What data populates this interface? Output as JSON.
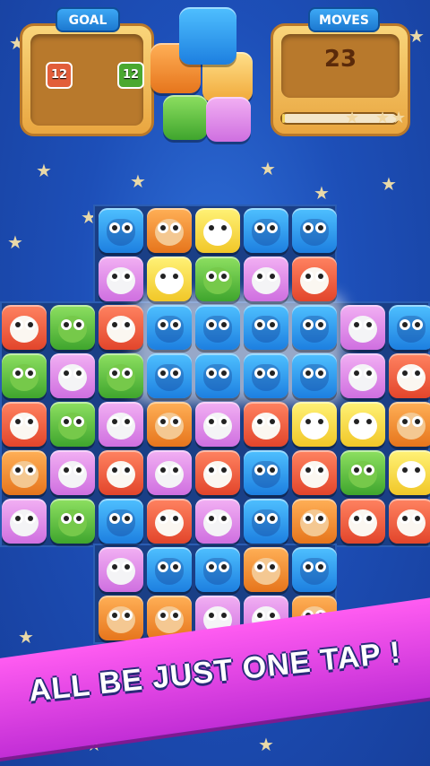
{
  "hud": {
    "goal_label": "GOAL",
    "moves_label": "MOVES",
    "moves_value": "23",
    "goals": [
      {
        "count": "12",
        "color": "#e25e3a"
      },
      {
        "count": "12",
        "color": "#4aa830"
      }
    ],
    "progress": 0.0
  },
  "banner": {
    "text": "ALL BE JUST ONE TAP !"
  },
  "board": {
    "rows": [
      [
        "owl",
        "hedgehog",
        "panda",
        "owl",
        "owl",
        "",
        "",
        "",
        "",
        ""
      ],
      [
        "cat",
        "panda",
        "frog",
        "cat",
        "kitty",
        "",
        "",
        "",
        "",
        ""
      ],
      [
        "kitty",
        "frog",
        "kitty",
        "owl",
        "owl",
        "owl",
        "owl",
        "cat",
        "owl",
        ""
      ],
      [
        "frog",
        "cat",
        "frog",
        "owl",
        "owl",
        "owl",
        "owl",
        "cat",
        "kitty",
        ""
      ],
      [
        "kitty",
        "frog",
        "cat",
        "hedgehog",
        "cat",
        "kitty",
        "panda",
        "panda",
        "hedgehog",
        ""
      ],
      [
        "hedgehog",
        "cat",
        "kitty",
        "cat",
        "kitty",
        "owl",
        "kitty",
        "frog",
        "panda",
        ""
      ],
      [
        "cat",
        "frog",
        "owl",
        "kitty",
        "cat",
        "owl",
        "hedgehog",
        "kitty",
        "kitty",
        ""
      ],
      [
        "",
        "",
        "cat",
        "owl",
        "owl",
        "hedgehog",
        "owl",
        "",
        "",
        ""
      ],
      [
        "",
        "",
        "hedgehog",
        "hedgehog",
        "cat",
        "cat",
        "hedgehog",
        "",
        "",
        ""
      ]
    ]
  }
}
